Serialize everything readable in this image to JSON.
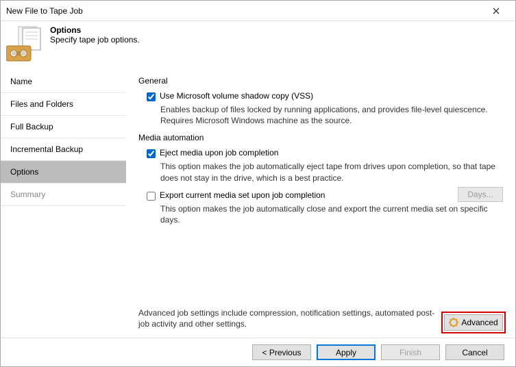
{
  "window": {
    "title": "New File to Tape Job"
  },
  "header": {
    "title": "Options",
    "subtitle": "Specify tape job options."
  },
  "sidebar": {
    "items": [
      {
        "label": "Name"
      },
      {
        "label": "Files and Folders"
      },
      {
        "label": "Full Backup"
      },
      {
        "label": "Incremental Backup"
      },
      {
        "label": "Options"
      },
      {
        "label": "Summary"
      }
    ],
    "active_index": 4
  },
  "content": {
    "general": {
      "title": "General",
      "vss": {
        "label": "Use Microsoft volume shadow copy (VSS)",
        "checked": true,
        "desc": "Enables backup of files locked by running applications, and provides file-level quiescence. Requires Microsoft Windows machine as the source."
      }
    },
    "media": {
      "title": "Media automation",
      "eject": {
        "label": "Eject media upon job completion",
        "checked": true,
        "desc": "This option makes the job automatically eject tape from drives upon completion, so that tape does not stay in the drive, which is a best practice."
      },
      "export": {
        "label": "Export current media set upon job completion",
        "checked": false,
        "desc": "This option makes the job automatically close and export the current media set on specific days.",
        "days_button": "Days..."
      }
    },
    "hint": "Advanced job settings include compression, notification settings, automated post-job activity and other settings.",
    "advanced_button": "Advanced"
  },
  "footer": {
    "previous": "< Previous",
    "apply": "Apply",
    "finish": "Finish",
    "cancel": "Cancel"
  }
}
